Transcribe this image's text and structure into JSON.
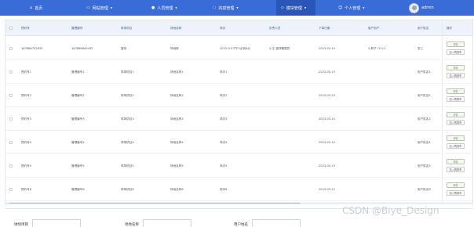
{
  "nav": {
    "home": {
      "label": "首页",
      "icon": "home-icon"
    },
    "items": [
      {
        "label": "网站管理",
        "icon": "monitor-icon"
      },
      {
        "label": "人员管理",
        "icon": "user-icon"
      },
      {
        "label": "内容管理",
        "icon": "chat-icon"
      },
      {
        "label": "模块管理",
        "icon": "puzzle-icon",
        "active": true
      },
      {
        "label": "个人管理",
        "icon": "person-icon"
      }
    ],
    "user": "admin"
  },
  "table": {
    "columns": [
      "预约号",
      "管理编号",
      "球场项目",
      "场地名称",
      "场次",
      "负责人员",
      "下单日期",
      "客户用户",
      "用户姓名",
      "操作"
    ],
    "rows": [
      [
        "167886792832",
        "167886640432",
        "篮球",
        "场地新",
        "2023-3-3下午5点到6点",
        "小王 篮球管理员",
        "2023-03-15",
        "小胖子 /1111",
        "张三"
      ],
      [
        "预约号1",
        "管理编号1",
        "球场项目1",
        "场地名称1",
        "场次1",
        "",
        "2023-03-15",
        "",
        "用户姓名1"
      ],
      [
        "预约号2",
        "管理编号2",
        "球场项目2",
        "场地名称2",
        "场次2",
        "",
        "2023-03-15",
        "",
        "用户姓名2"
      ],
      [
        "预约号3",
        "管理编号3",
        "球场项目3",
        "场地名称3",
        "场次3",
        "",
        "2023-03-15",
        "",
        "用户姓名3"
      ],
      [
        "预约号4",
        "管理编号4",
        "球场项目4",
        "场地名称4",
        "场次4",
        "",
        "2023-03-15",
        "",
        "用户姓名4"
      ],
      [
        "预约号5",
        "管理编号5",
        "球场项目5",
        "场地名称5",
        "场次5",
        "",
        "2023-03-15",
        "",
        "用户姓名5"
      ],
      [
        "预约号6",
        "管理编号6",
        "球场项目6",
        "场地名称6",
        "场次6",
        "",
        "2023-03-12",
        "",
        "用户姓名6"
      ]
    ],
    "actions": {
      "detail": "详情",
      "add_cart": "加入购物车"
    }
  },
  "filter": {
    "fields": [
      {
        "label": "球场项目",
        "value": ""
      },
      {
        "label": "场地名称",
        "value": ""
      },
      {
        "label": "用户姓名",
        "value": ""
      }
    ]
  },
  "watermark": "CSDN @Biye_Design"
}
